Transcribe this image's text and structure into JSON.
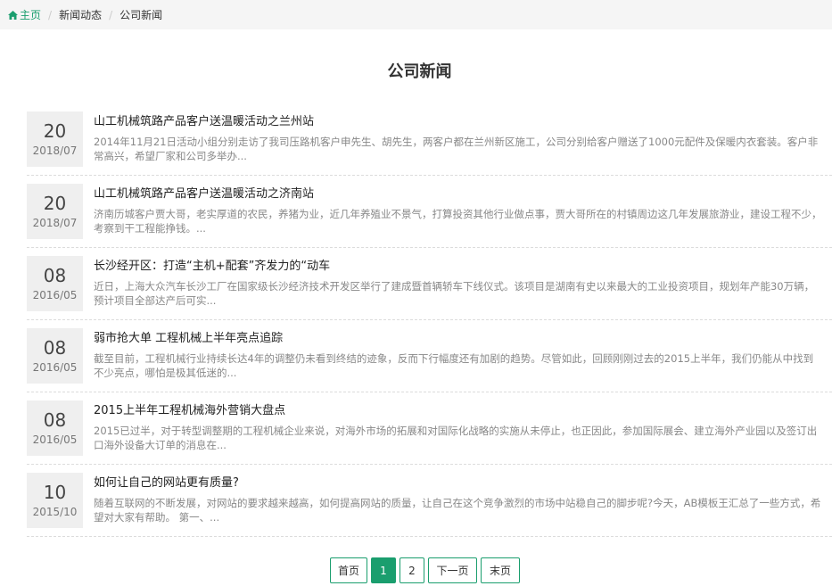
{
  "breadcrumb": {
    "home_label": "主页",
    "items": [
      "新闻动态",
      "公司新闻"
    ],
    "separator": "/"
  },
  "page": {
    "title": "公司新闻"
  },
  "news": [
    {
      "day": "20",
      "ym": "2018/07",
      "title": "山工机械筑路产品客户送温暖活动之兰州站",
      "desc": "2014年11月21日活动小组分别走访了我司压路机客户申先生、胡先生，两客户都在兰州新区施工，公司分别给客户赠送了1000元配件及保暖内衣套装。客户非常高兴，希望厂家和公司多举办..."
    },
    {
      "day": "20",
      "ym": "2018/07",
      "title": "山工机械筑路产品客户送温暖活动之济南站",
      "desc": "济南历城客户贾大哥，老实厚道的农民，养猪为业，近几年养殖业不景气，打算投资其他行业做点事，贾大哥所在的村镇周边这几年发展旅游业，建设工程不少，考察到干工程能挣钱。..."
    },
    {
      "day": "08",
      "ym": "2016/05",
      "title": "长沙经开区：打造“主机+配套”齐发力的“动车",
      "desc": "近日，上海大众汽车长沙工厂在国家级长沙经济技术开发区举行了建成暨首辆轿车下线仪式。该项目是湖南有史以来最大的工业投资项目，规划年产能30万辆，预计项目全部达产后可实..."
    },
    {
      "day": "08",
      "ym": "2016/05",
      "title": "弱市抢大单 工程机械上半年亮点追踪",
      "desc": "截至目前，工程机械行业持续长达4年的调整仍未看到终结的迹象，反而下行幅度还有加剧的趋势。尽管如此，回顾刚刚过去的2015上半年，我们仍能从中找到不少亮点，哪怕是极其低迷的..."
    },
    {
      "day": "08",
      "ym": "2016/05",
      "title": "2015上半年工程机械海外营销大盘点",
      "desc": "2015已过半，对于转型调整期的工程机械企业来说，对海外市场的拓展和对国际化战略的实施从未停止，也正因此，参加国际展会、建立海外产业园以及签订出口海外设备大订单的消息在..."
    },
    {
      "day": "10",
      "ym": "2015/10",
      "title": "如何让自己的网站更有质量?",
      "desc": "随着互联网的不断发展，对网站的要求越来越高，如何提高网站的质量，让自己在这个竞争激烈的市场中站稳自己的脚步呢?今天，AB模板王汇总了一些方式，希望对大家有帮助。 第一、..."
    }
  ],
  "pager": {
    "first": "首页",
    "pages": [
      "1",
      "2"
    ],
    "active": "1",
    "next": "下一页",
    "last": "末页"
  },
  "colors": {
    "accent": "#1a9e6e"
  }
}
